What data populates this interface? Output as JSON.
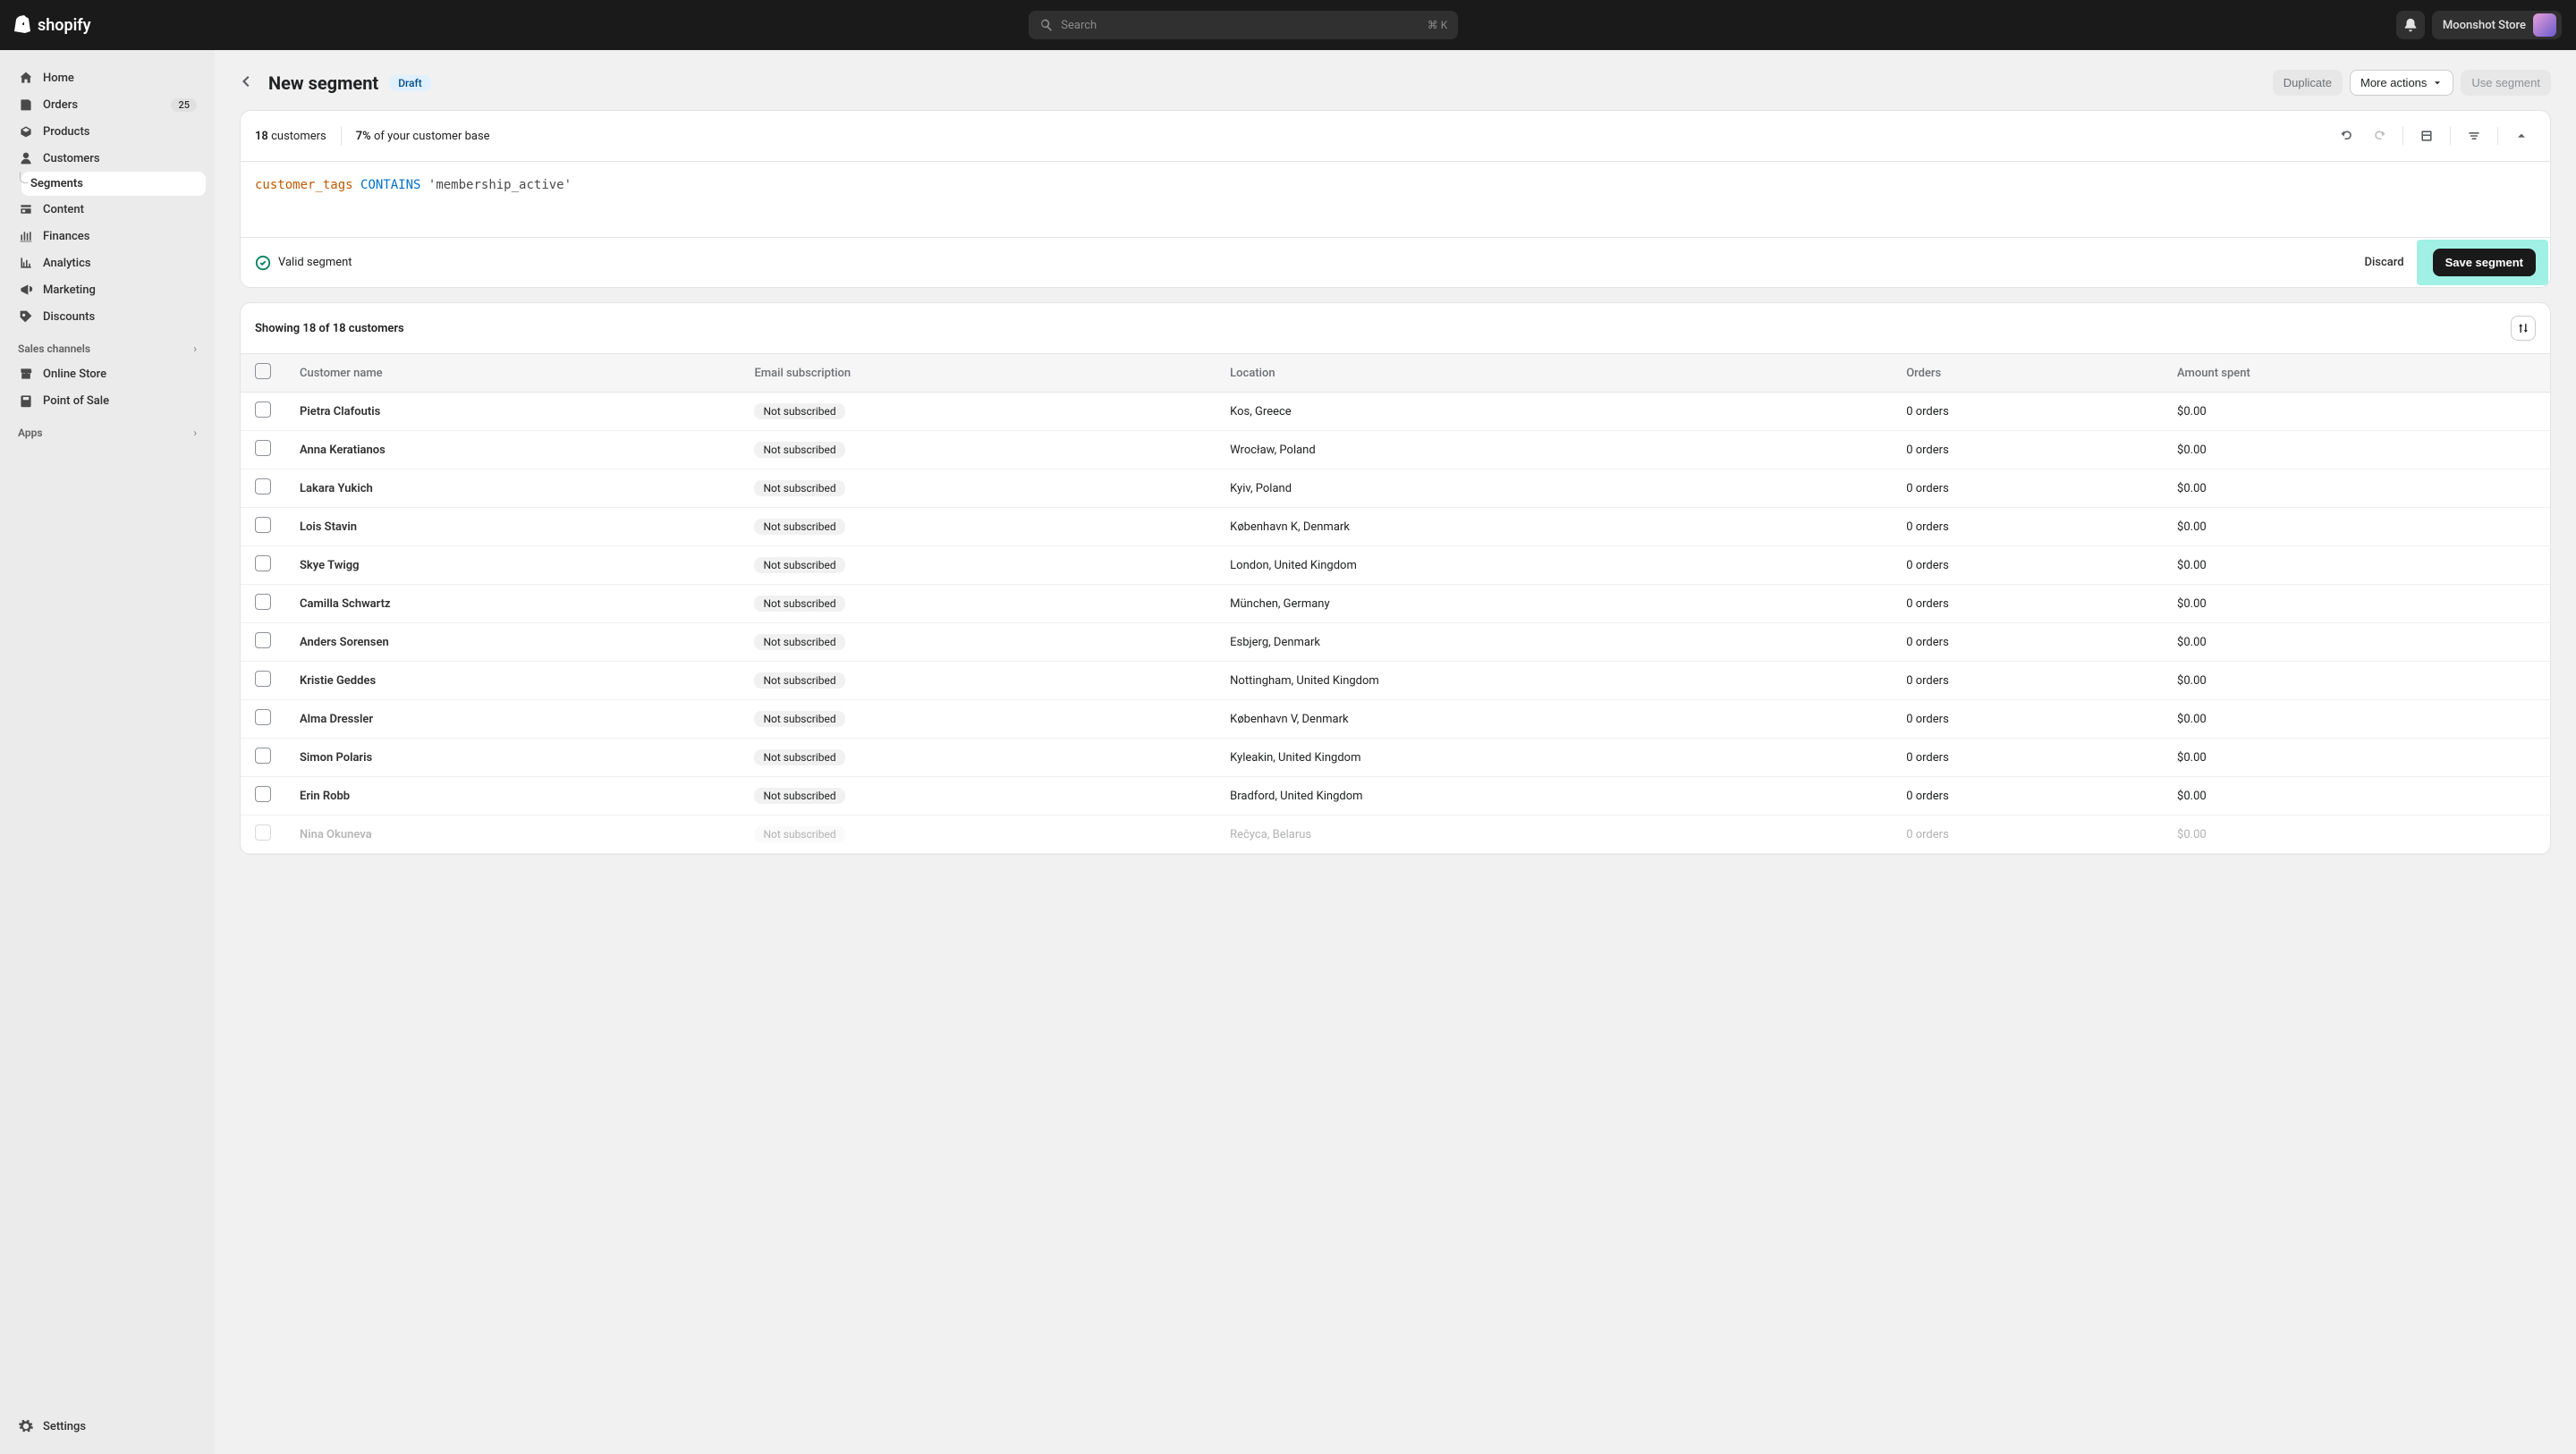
{
  "header": {
    "brand": "shopify",
    "search_placeholder": "Search",
    "search_shortcut": "⌘ K",
    "store_name": "Moonshot Store"
  },
  "sidebar": {
    "items": [
      {
        "label": "Home",
        "icon": "home"
      },
      {
        "label": "Orders",
        "icon": "orders",
        "badge": "25"
      },
      {
        "label": "Products",
        "icon": "products"
      },
      {
        "label": "Customers",
        "icon": "customers"
      },
      {
        "label": "Segments",
        "icon": "sub",
        "active": true,
        "sub": true
      },
      {
        "label": "Content",
        "icon": "content"
      },
      {
        "label": "Finances",
        "icon": "finances"
      },
      {
        "label": "Analytics",
        "icon": "analytics"
      },
      {
        "label": "Marketing",
        "icon": "marketing"
      },
      {
        "label": "Discounts",
        "icon": "discounts"
      }
    ],
    "sections": [
      {
        "label": "Sales channels",
        "items": [
          {
            "label": "Online Store",
            "icon": "onlinestore"
          },
          {
            "label": "Point of Sale",
            "icon": "pos"
          }
        ]
      },
      {
        "label": "Apps",
        "items": []
      }
    ],
    "settings": "Settings"
  },
  "page": {
    "title": "New segment",
    "badge": "Draft",
    "actions": {
      "duplicate": "Duplicate",
      "more": "More actions",
      "use": "Use segment"
    }
  },
  "editor": {
    "count_number": "18",
    "count_label": "customers",
    "percent_number": "7%",
    "percent_label": "of your customer base",
    "code_field": "customer_tags",
    "code_op": "CONTAINS",
    "code_str": "'membership_active'",
    "valid": "Valid segment",
    "discard": "Discard",
    "save": "Save segment"
  },
  "results": {
    "showing": "Showing 18 of 18 customers",
    "columns": {
      "name": "Customer name",
      "email": "Email subscription",
      "location": "Location",
      "orders": "Orders",
      "amount": "Amount spent"
    },
    "rows": [
      {
        "name": "Pietra Clafoutis",
        "email": "Not subscribed",
        "location": "Kos, Greece",
        "orders": "0 orders",
        "amount": "$0.00"
      },
      {
        "name": "Anna Keratianos",
        "email": "Not subscribed",
        "location": "Wrocław, Poland",
        "orders": "0 orders",
        "amount": "$0.00"
      },
      {
        "name": "Lakara Yukich",
        "email": "Not subscribed",
        "location": "Kyiv, Poland",
        "orders": "0 orders",
        "amount": "$0.00"
      },
      {
        "name": "Lois Stavin",
        "email": "Not subscribed",
        "location": "København K, Denmark",
        "orders": "0 orders",
        "amount": "$0.00"
      },
      {
        "name": "Skye Twigg",
        "email": "Not subscribed",
        "location": "London, United Kingdom",
        "orders": "0 orders",
        "amount": "$0.00"
      },
      {
        "name": "Camilla Schwartz",
        "email": "Not subscribed",
        "location": "München, Germany",
        "orders": "0 orders",
        "amount": "$0.00"
      },
      {
        "name": "Anders Sorensen",
        "email": "Not subscribed",
        "location": "Esbjerg, Denmark",
        "orders": "0 orders",
        "amount": "$0.00"
      },
      {
        "name": "Kristie Geddes",
        "email": "Not subscribed",
        "location": "Nottingham, United Kingdom",
        "orders": "0 orders",
        "amount": "$0.00"
      },
      {
        "name": "Alma Dressler",
        "email": "Not subscribed",
        "location": "København V, Denmark",
        "orders": "0 orders",
        "amount": "$0.00"
      },
      {
        "name": "Simon Polaris",
        "email": "Not subscribed",
        "location": "Kyleakin, United Kingdom",
        "orders": "0 orders",
        "amount": "$0.00"
      },
      {
        "name": "Erin Robb",
        "email": "Not subscribed",
        "location": "Bradford, United Kingdom",
        "orders": "0 orders",
        "amount": "$0.00"
      },
      {
        "name": "Nina Okuneva",
        "email": "Not subscribed",
        "location": "Rečyca, Belarus",
        "orders": "0 orders",
        "amount": "$0.00",
        "fade": true
      }
    ]
  }
}
